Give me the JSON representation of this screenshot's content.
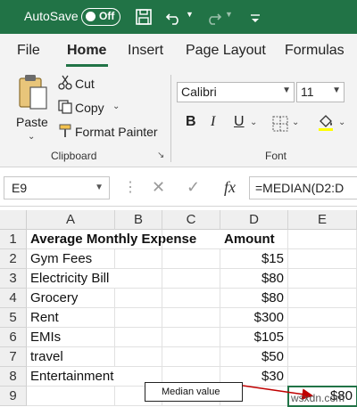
{
  "titlebar": {
    "autosave_label": "AutoSave",
    "autosave_state": "Off"
  },
  "tabs": [
    {
      "label": "File"
    },
    {
      "label": "Home"
    },
    {
      "label": "Insert"
    },
    {
      "label": "Page Layout"
    },
    {
      "label": "Formulas"
    }
  ],
  "ribbon": {
    "paste_label": "Paste",
    "cut_label": "Cut",
    "copy_label": "Copy",
    "format_painter_label": "Format Painter",
    "clipboard_group": "Clipboard",
    "font_name": "Calibri",
    "font_size": "11",
    "bold_label": "B",
    "italic_label": "I",
    "underline_label": "U",
    "font_group": "Font"
  },
  "formula_bar": {
    "name_box": "E9",
    "fx_label": "fx",
    "formula": "=MEDIAN(D2:D"
  },
  "columns": [
    "A",
    "B",
    "C",
    "D",
    "E"
  ],
  "rows": [
    "1",
    "2",
    "3",
    "4",
    "5",
    "6",
    "7",
    "8",
    "9"
  ],
  "cells": {
    "r1": {
      "a": "Average Monthly Expense",
      "d": "Amount"
    },
    "r2": {
      "a": "Gym Fees",
      "d": "$15"
    },
    "r3": {
      "a": "Electricity Bill",
      "d": "$80"
    },
    "r4": {
      "a": "Grocery",
      "d": "$80"
    },
    "r5": {
      "a": "Rent",
      "d": "$300"
    },
    "r6": {
      "a": "EMIs",
      "d": "$105"
    },
    "r7": {
      "a": "travel",
      "d": "$50"
    },
    "r8": {
      "a": "Entertainment",
      "d": "$30"
    },
    "r9": {
      "e": "$80"
    }
  },
  "annotation": "Median value",
  "watermark": "wsxdn.com",
  "colors": {
    "excel_green": "#217346",
    "arrow": "#c00000"
  }
}
